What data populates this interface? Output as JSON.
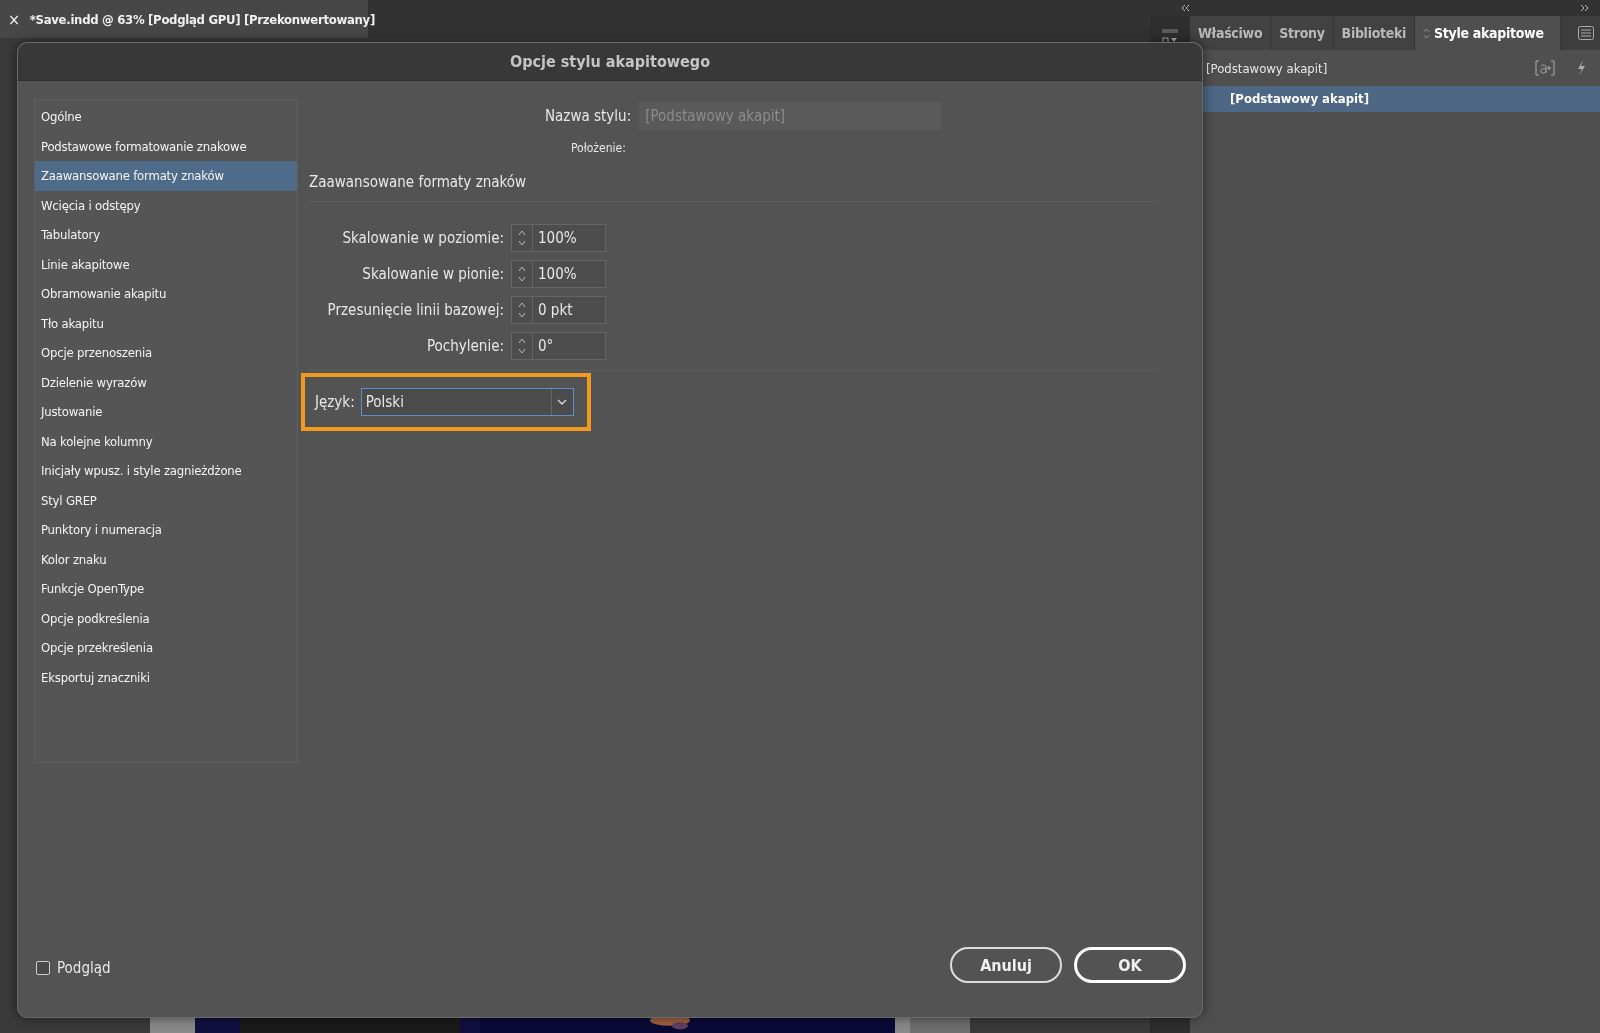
{
  "document_tab": {
    "close": "×",
    "title": "*Save.indd @ 63% [Podgląd GPU] [Przekonwertowany]"
  },
  "panel": {
    "tabs": [
      {
        "label": "Właściwo",
        "selected": false
      },
      {
        "label": "Strony",
        "selected": false
      },
      {
        "label": "Biblioteki",
        "selected": false
      },
      {
        "label": "Style akapitowe",
        "selected": true
      }
    ],
    "current_style": "[Podstawowy akapit]",
    "styles": [
      {
        "label": "[Podstawowy akapit]",
        "selected": true
      }
    ]
  },
  "dialog": {
    "title": "Opcje stylu akapitowego",
    "sidebar": [
      {
        "label": "Ogólne",
        "selected": false
      },
      {
        "label": "Podstawowe formatowanie znakowe",
        "selected": false
      },
      {
        "label": "Zaawansowane formaty znaków",
        "selected": true
      },
      {
        "label": "Wcięcia i odstępy",
        "selected": false
      },
      {
        "label": "Tabulatory",
        "selected": false
      },
      {
        "label": "Linie akapitowe",
        "selected": false
      },
      {
        "label": "Obramowanie akapitu",
        "selected": false
      },
      {
        "label": "Tło akapitu",
        "selected": false
      },
      {
        "label": "Opcje przenoszenia",
        "selected": false
      },
      {
        "label": "Dzielenie wyrazów",
        "selected": false
      },
      {
        "label": "Justowanie",
        "selected": false
      },
      {
        "label": "Na kolejne kolumny",
        "selected": false
      },
      {
        "label": "Inicjały wpusz. i style zagnieżdżone",
        "selected": false
      },
      {
        "label": "Styl GREP",
        "selected": false
      },
      {
        "label": "Punktory i numeracja",
        "selected": false
      },
      {
        "label": "Kolor znaku",
        "selected": false
      },
      {
        "label": "Funkcje OpenType",
        "selected": false
      },
      {
        "label": "Opcje podkreślenia",
        "selected": false
      },
      {
        "label": "Opcje przekreślenia",
        "selected": false
      },
      {
        "label": "Eksportuj znaczniki",
        "selected": false
      }
    ],
    "style_name": {
      "label": "Nazwa stylu:",
      "value": "[Podstawowy akapit]",
      "disabled": true
    },
    "position_label": "Położenie:",
    "section_title": "Zaawansowane formaty znaków",
    "fields": [
      {
        "label": "Skalowanie w poziomie:",
        "value": "100%"
      },
      {
        "label": "Skalowanie w pionie:",
        "value": "100%"
      },
      {
        "label": "Przesunięcie linii bazowej:",
        "value": "0 pkt"
      },
      {
        "label": "Pochylenie:",
        "value": "0°"
      }
    ],
    "language": {
      "label": "Język:",
      "value": "Polski",
      "highlighted": true
    },
    "preview": {
      "label": "Podgląd",
      "checked": false
    },
    "buttons": [
      {
        "label": "Anuluj",
        "kind": "cancel"
      },
      {
        "label": "OK",
        "kind": "default"
      }
    ]
  }
}
